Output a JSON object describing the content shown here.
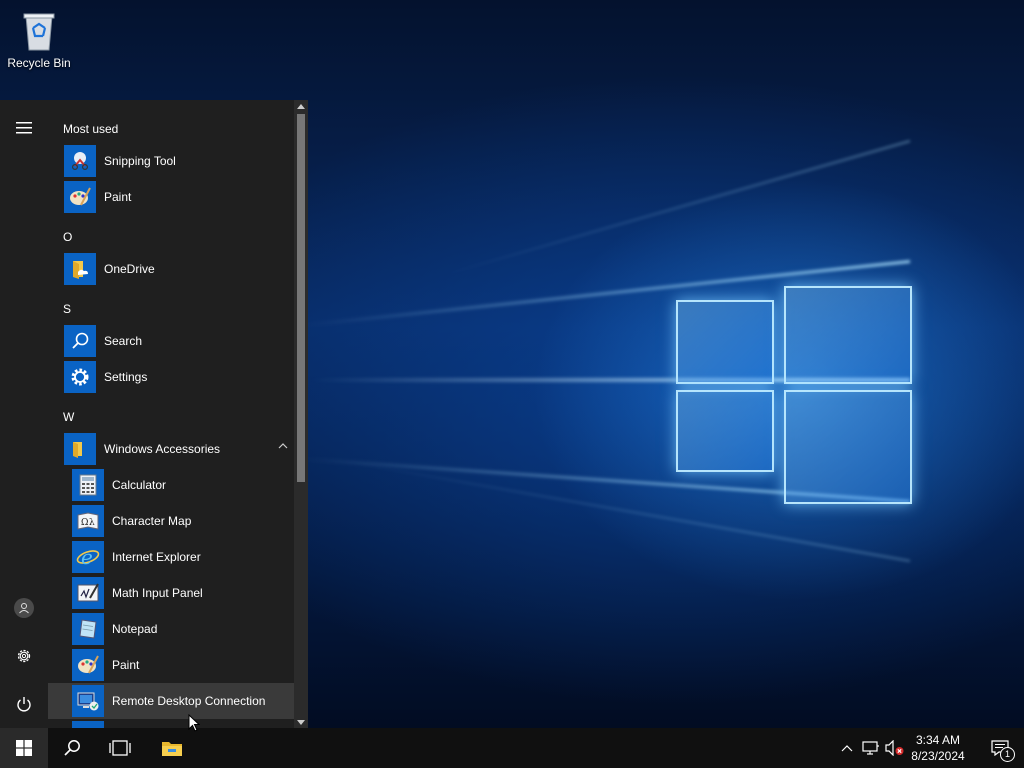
{
  "desktop": {
    "recycle_bin_label": "Recycle Bin"
  },
  "start_menu": {
    "groups": {
      "most_used": "Most used",
      "o": "O",
      "s": "S",
      "w": "W"
    },
    "apps": {
      "snipping_tool": "Snipping Tool",
      "paint": "Paint",
      "onedrive": "OneDrive",
      "search": "Search",
      "settings": "Settings",
      "windows_accessories": "Windows Accessories",
      "calculator": "Calculator",
      "character_map": "Character Map",
      "internet_explorer": "Internet Explorer",
      "math_input_panel": "Math Input Panel",
      "notepad": "Notepad",
      "paint_accessory": "Paint",
      "remote_desktop": "Remote Desktop Connection"
    },
    "hovered_item": "Remote Desktop Connection"
  },
  "taskbar": {
    "time": "3:34 AM",
    "date": "8/23/2024",
    "notification_count": "1"
  },
  "colors": {
    "tile_blue": "#0a63c4",
    "menu_bg": "#1f1f1f",
    "taskbar_bg": "#101010",
    "hover_bg": "#3a3a3a"
  },
  "icons": [
    "hamburger-menu-icon",
    "user-icon",
    "gear-icon",
    "power-icon",
    "windows-logo-icon",
    "search-icon",
    "task-view-icon",
    "file-explorer-icon",
    "chevron-up-icon",
    "network-icon",
    "volume-muted-icon",
    "notification-icon"
  ]
}
